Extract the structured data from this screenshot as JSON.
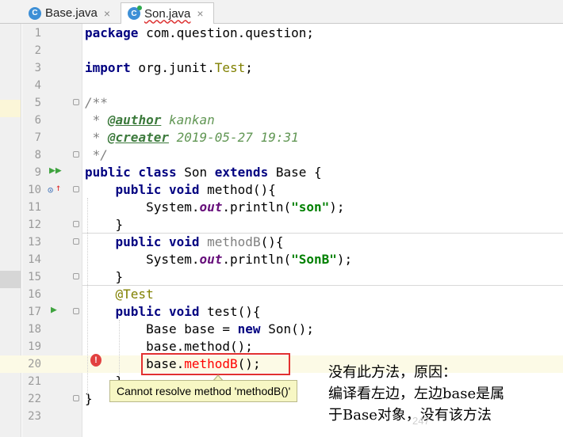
{
  "tabs": [
    {
      "label": "Base.java",
      "icon": "class-icon",
      "active": false
    },
    {
      "label": "Son.java",
      "icon": "class-icon",
      "active": true
    }
  ],
  "lines": [
    {
      "n": "1",
      "segs": [
        [
          "kw",
          "package"
        ],
        [
          "t",
          " com.question.question;"
        ]
      ]
    },
    {
      "n": "2",
      "segs": []
    },
    {
      "n": "3",
      "segs": [
        [
          "kw",
          "import"
        ],
        [
          "t",
          " org.junit."
        ],
        [
          "cls",
          "Test"
        ],
        [
          "t",
          ";"
        ]
      ]
    },
    {
      "n": "4",
      "segs": []
    },
    {
      "n": "5",
      "segs": [
        [
          "cm",
          "/**"
        ]
      ]
    },
    {
      "n": "6",
      "segs": [
        [
          "cm",
          " * "
        ],
        [
          "tag",
          "@author"
        ],
        [
          "doc",
          " kankan"
        ]
      ]
    },
    {
      "n": "7",
      "segs": [
        [
          "cm",
          " * "
        ],
        [
          "tag",
          "@creater"
        ],
        [
          "doc",
          " 2019-05-27 19:31"
        ]
      ]
    },
    {
      "n": "8",
      "segs": [
        [
          "cm",
          " */"
        ]
      ]
    },
    {
      "n": "9",
      "segs": [
        [
          "kw",
          "public class"
        ],
        [
          "t",
          " Son "
        ],
        [
          "kw",
          "extends"
        ],
        [
          "t",
          " Base {"
        ]
      ]
    },
    {
      "n": "10",
      "segs": [
        [
          "t",
          "    "
        ],
        [
          "kw",
          "public void"
        ],
        [
          "t",
          " method(){"
        ]
      ]
    },
    {
      "n": "11",
      "segs": [
        [
          "t",
          "        System."
        ],
        [
          "fld",
          "out"
        ],
        [
          "t",
          ".println("
        ],
        [
          "str",
          "\"son\""
        ],
        [
          "t",
          ");"
        ]
      ]
    },
    {
      "n": "12",
      "segs": [
        [
          "t",
          "    }"
        ]
      ]
    },
    {
      "n": "13",
      "segs": [
        [
          "t",
          "    "
        ],
        [
          "kw",
          "public void"
        ],
        [
          "t",
          " "
        ],
        [
          "unused",
          "methodB"
        ],
        [
          "t",
          "(){"
        ]
      ]
    },
    {
      "n": "14",
      "segs": [
        [
          "t",
          "        System."
        ],
        [
          "fld",
          "out"
        ],
        [
          "t",
          ".println("
        ],
        [
          "str",
          "\"SonB\""
        ],
        [
          "t",
          ");"
        ]
      ]
    },
    {
      "n": "15",
      "segs": [
        [
          "t",
          "    }"
        ]
      ]
    },
    {
      "n": "16",
      "segs": [
        [
          "t",
          "    "
        ],
        [
          "ann",
          "@Test"
        ]
      ]
    },
    {
      "n": "17",
      "segs": [
        [
          "t",
          "    "
        ],
        [
          "kw",
          "public void"
        ],
        [
          "t",
          " test(){"
        ]
      ]
    },
    {
      "n": "18",
      "segs": [
        [
          "t",
          "        Base base = "
        ],
        [
          "kw",
          "new"
        ],
        [
          "t",
          " Son();"
        ]
      ]
    },
    {
      "n": "19",
      "segs": [
        [
          "t",
          "        base.method();"
        ]
      ]
    },
    {
      "n": "20",
      "segs": [
        [
          "t",
          "        base."
        ],
        [
          "err",
          "methodB"
        ],
        [
          "t",
          "();"
        ]
      ]
    },
    {
      "n": "21",
      "segs": [
        [
          "t",
          "    }"
        ]
      ]
    },
    {
      "n": "22",
      "segs": [
        [
          "t",
          "}"
        ]
      ]
    },
    {
      "n": "23",
      "segs": []
    }
  ],
  "tooltip": {
    "text": "Cannot resolve method 'methodB()'"
  },
  "annotation": {
    "line1": "没有此方法，原因：",
    "line2": "编译看左边，左边base是属",
    "line3": "于Base对象，没有该方法"
  },
  "watermark": "247",
  "colors": {
    "error": "#e23030",
    "keyword": "#000080",
    "string": "#008000",
    "tooltip_bg": "#f7f7c4"
  }
}
